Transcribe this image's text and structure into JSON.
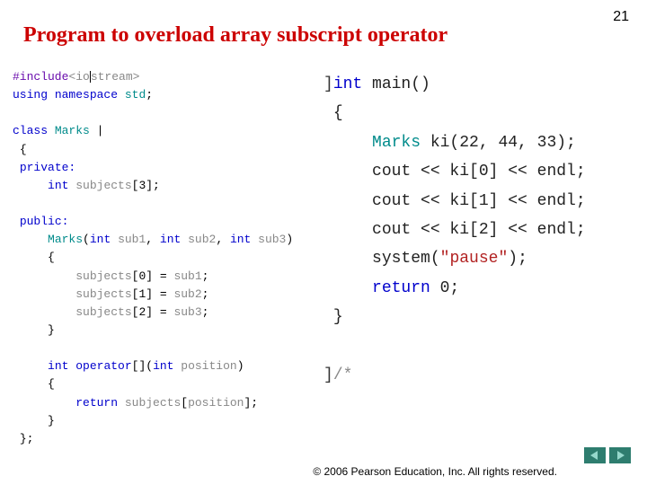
{
  "page_number": "21",
  "title": "Program to overload array subscript operator",
  "left": {
    "l1a": "#include",
    "l1b": "<io",
    "l1c": "stream>",
    "l2a": "using",
    "l2b": "namespace",
    "l2c": "std",
    "l2d": ";",
    "l3a": "class",
    "l3b": "Marks",
    "l4": "{",
    "l5": "private:",
    "l6a": "int",
    "l6b": "subjects",
    "l6c": "[3];",
    "l7": "public:",
    "l8a": "Marks",
    "l8b": "(",
    "l8c": "int",
    "l8d": "sub1",
    "l8e": ", ",
    "l8f": "int",
    "l8g": "sub2",
    "l8h": ", ",
    "l8i": "int",
    "l8j": "sub3",
    "l8k": ")",
    "l9": "{",
    "l10a": "subjects",
    "l10b": "[0] = ",
    "l10c": "sub1",
    "l10d": ";",
    "l11a": "subjects",
    "l11b": "[1] = ",
    "l11c": "sub2",
    "l11d": ";",
    "l12a": "subjects",
    "l12b": "[2] = ",
    "l12c": "sub3",
    "l12d": ";",
    "l13": "}",
    "l14a": "int",
    "l14b": "operator",
    "l14c": "[](",
    "l14d": "int",
    "l14e": "position",
    "l14f": ")",
    "l15": "{",
    "l16a": "return",
    "l16b": "subjects",
    "l16c": "[",
    "l16d": "position",
    "l16e": "];",
    "l17": "}",
    "l18": "};"
  },
  "right": {
    "r1a": "int",
    "r1b": " main()",
    "r2": "{",
    "r3a": "Marks",
    "r3b": " ki(22, 44, 33);",
    "r4": "cout << ki[0] << endl;",
    "r5": "cout << ki[1] << endl;",
    "r6": "cout << ki[2] << endl;",
    "r7a": "system(",
    "r7b": "\"pause\"",
    "r7c": ");",
    "r8a": "return",
    "r8b": " 0;",
    "r9": "}",
    "r10": "/*"
  },
  "footer": "© 2006 Pearson Education, Inc.  All rights reserved."
}
